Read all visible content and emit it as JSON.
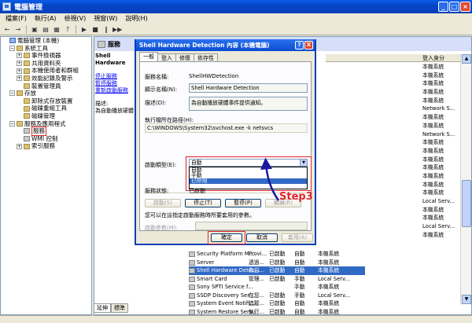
{
  "window": {
    "title": "電腦管理"
  },
  "menu": [
    "檔案(F)",
    "執行(A)",
    "檢視(V)",
    "視窗(W)",
    "說明(H)"
  ],
  "toolbar": [
    "←",
    "→",
    "▣",
    "▤",
    "▦",
    "?",
    "▶",
    "■",
    "‖",
    "▶▶"
  ],
  "tree": [
    {
      "indent": 0,
      "pm": "",
      "icon": "computer-icon",
      "label": "電腦管理 (本機)"
    },
    {
      "indent": 1,
      "pm": "−",
      "icon": "tools-icon",
      "label": "系統工具"
    },
    {
      "indent": 2,
      "pm": "+",
      "icon": "event-viewer-icon",
      "label": "事件檢視器"
    },
    {
      "indent": 2,
      "pm": "+",
      "icon": "shared-folder-icon",
      "label": "共用資料夾"
    },
    {
      "indent": 2,
      "pm": "+",
      "icon": "users-icon",
      "label": "本機使用者和群組"
    },
    {
      "indent": 2,
      "pm": "+",
      "icon": "performance-icon",
      "label": "效能記錄及警示"
    },
    {
      "indent": 2,
      "pm": "",
      "icon": "device-manager-icon",
      "label": "裝置管理員"
    },
    {
      "indent": 1,
      "pm": "−",
      "icon": "storage-icon",
      "label": "存放"
    },
    {
      "indent": 2,
      "pm": "",
      "icon": "removable-storage-icon",
      "label": "卸除式存放裝置"
    },
    {
      "indent": 2,
      "pm": "",
      "icon": "defrag-icon",
      "label": "磁碟重組工具"
    },
    {
      "indent": 2,
      "pm": "",
      "icon": "disk-icon",
      "label": "磁碟管理"
    },
    {
      "indent": 1,
      "pm": "−",
      "icon": "services-apps-icon",
      "label": "服務及應用程式"
    },
    {
      "indent": 2,
      "pm": "",
      "icon": "gear-icon",
      "label": "服務",
      "selected": true
    },
    {
      "indent": 2,
      "pm": "",
      "icon": "wmi-icon",
      "label": "WMI 控制"
    },
    {
      "indent": 2,
      "pm": "+",
      "icon": "index-icon",
      "label": "索引服務"
    }
  ],
  "right": {
    "header": "服務",
    "desc_title": "Shell Hardware",
    "links": [
      "停止服務",
      "暫停服務",
      "重新啟動服務"
    ],
    "desc_label": "描述:",
    "desc_text": "為自動播放硬體",
    "list_header": {
      "col_a": "",
      "col_b": "登入身分"
    },
    "upper_rows": [
      {
        "a": "",
        "b": "本機系統"
      },
      {
        "a": "",
        "b": "本機系統"
      },
      {
        "a": "",
        "b": "本機系統"
      },
      {
        "a": "",
        "b": "本機系統"
      },
      {
        "a": "",
        "b": "本機系統"
      },
      {
        "a": "",
        "b": "Network S..."
      },
      {
        "a": "",
        "b": "本機系統"
      },
      {
        "a": "",
        "b": "本機系統"
      },
      {
        "a": "",
        "b": "Network S..."
      },
      {
        "a": "",
        "b": "本機系統"
      },
      {
        "a": "",
        "b": "本機系統"
      },
      {
        "a": "",
        "b": "本機系統"
      },
      {
        "a": "",
        "b": "本機系統"
      },
      {
        "a": "",
        "b": "本機系統"
      },
      {
        "a": "",
        "b": "本機系統"
      },
      {
        "a": "",
        "b": "本機系統"
      },
      {
        "a": "",
        "b": "Local Serv..."
      },
      {
        "a": "",
        "b": "本機系統"
      },
      {
        "a": "",
        "b": "本機系統"
      },
      {
        "a": "",
        "b": "Local Serv..."
      },
      {
        "a": "",
        "b": "本機系統"
      }
    ],
    "lower_rows": [
      {
        "name": "Security Platform M...",
        "desc": "Provi...",
        "status": "已啟動",
        "startup": "自動",
        "logon": "本機系統"
      },
      {
        "name": "Server",
        "desc": "透過...",
        "status": "已啟動",
        "startup": "自動",
        "logon": "本機系統"
      },
      {
        "name": "Shell Hardware Detec...",
        "desc": "為自...",
        "status": "已啟動",
        "startup": "自動",
        "logon": "本機系統",
        "highlight": true
      },
      {
        "name": "Smart Card",
        "desc": "管理...",
        "status": "已啟動",
        "startup": "手動",
        "logon": "Local Serv..."
      },
      {
        "name": "Sony SPTI Service f...",
        "desc": "",
        "status": "",
        "startup": "手動",
        "logon": "本機系統"
      },
      {
        "name": "SSDP Discovery Ser...",
        "desc": "在您...",
        "status": "已啟動",
        "startup": "手動",
        "logon": "Local Serv..."
      },
      {
        "name": "System Event Notifi...",
        "desc": "追蹤...",
        "status": "已啟動",
        "startup": "自動",
        "logon": "本機系統"
      },
      {
        "name": "System Restore Serv...",
        "desc": "執行...",
        "status": "已啟動",
        "startup": "自動",
        "logon": "本機系統"
      }
    ],
    "bottom_tabs": [
      "延伸",
      "標準"
    ]
  },
  "dialog": {
    "title": "Shell Hardware Detection 內容 (本機電腦)",
    "help": "?",
    "close": "X",
    "tabs": [
      "一般",
      "登入",
      "修復",
      "依存性"
    ],
    "service_name_label": "服務名稱:",
    "service_name": "ShellHWDetection",
    "display_name_label": "顯示名稱(N):",
    "display_name": "Shell Hardware Detection",
    "desc_label": "描述(D):",
    "desc": "為自動播放硬體事件提供通知。",
    "path_label": "執行檔所在路徑(H):",
    "path": "C:\\WINDOWS\\System32\\svchost.exe -k netsvcs",
    "startup_label": "啟動類型(E):",
    "startup_value": "自動",
    "startup_options": [
      "自動",
      "手動",
      "已停用"
    ],
    "startup_selected": 2,
    "status_label": "服務狀態:",
    "status_value": "已啟動",
    "btn_start": "啟動(S)",
    "btn_stop": "停止(T)",
    "btn_pause": "暫停(P)",
    "btn_resume": "繼續(R)",
    "note": "您可以在這指定啟動服務時所要套用的參數。",
    "params_label": "啟動參數(M):",
    "ok": "確定",
    "cancel": "取消",
    "apply": "套用(A)"
  },
  "annotation": {
    "text": "Step3",
    "color": "#e0262b"
  }
}
